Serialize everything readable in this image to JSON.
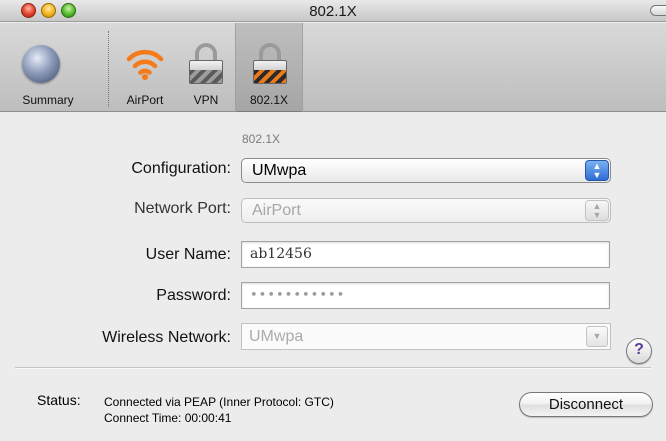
{
  "window": {
    "title": "802.1X"
  },
  "toolbar": {
    "items": [
      {
        "label": "Summary",
        "icon": "globe-icon"
      },
      {
        "label": "AirPort",
        "icon": "wifi-icon"
      },
      {
        "label": "VPN",
        "icon": "lock-icon"
      },
      {
        "label": "802.1X",
        "icon": "lock-orange-icon",
        "selected": true
      }
    ]
  },
  "form": {
    "section_caption": "802.1X",
    "configuration": {
      "label": "Configuration:",
      "value": "UMwpa"
    },
    "network_port": {
      "label": "Network Port:",
      "value": "AirPort"
    },
    "user_name": {
      "label": "User Name:",
      "value": "ab12456"
    },
    "password": {
      "label": "Password:",
      "value": "•••••••••••"
    },
    "wireless_network": {
      "label": "Wireless Network:",
      "value": "UMwpa"
    },
    "help_label": "?"
  },
  "status": {
    "label": "Status:",
    "line1": "Connected via PEAP (Inner Protocol: GTC)",
    "line2": "Connect Time: 00:00:41"
  },
  "actions": {
    "disconnect_label": "Disconnect"
  },
  "colors": {
    "accent": "#2f6dd6",
    "airport_orange": "#f47a1a",
    "help_purple": "#5a3d9c"
  }
}
